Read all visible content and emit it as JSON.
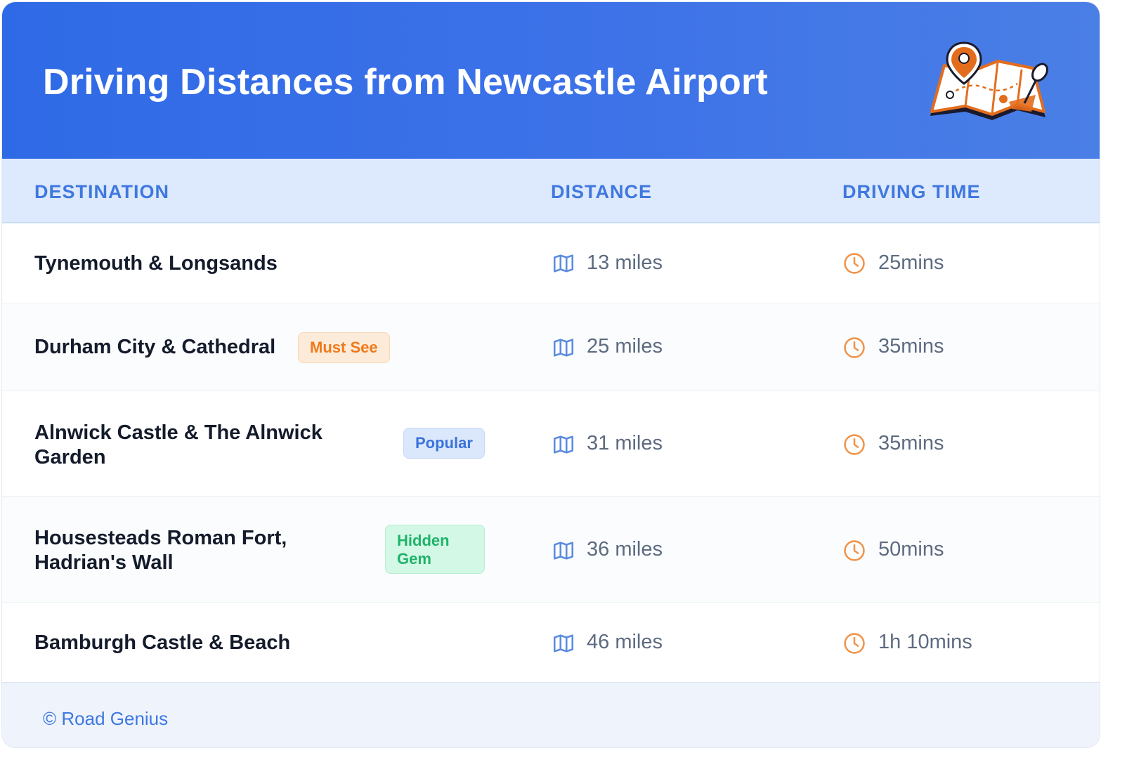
{
  "header": {
    "title": "Driving Distances from Newcastle Airport"
  },
  "columns": {
    "destination": "DESTINATION",
    "distance": "DISTANCE",
    "time": "DRIVING TIME"
  },
  "rows": [
    {
      "destination": "Tynemouth & Longsands",
      "badge": "",
      "distance": "13 miles",
      "time": "25mins"
    },
    {
      "destination": "Durham City & Cathedral",
      "badge": "Must See",
      "distance": "25 miles",
      "time": "35mins"
    },
    {
      "destination": "Alnwick Castle & The Alnwick Garden",
      "badge": "Popular",
      "distance": "31 miles",
      "time": "35mins"
    },
    {
      "destination": "Housesteads Roman Fort, Hadrian's Wall",
      "badge": "Hidden Gem",
      "distance": "36 miles",
      "time": "50mins"
    },
    {
      "destination": "Bamburgh Castle & Beach",
      "badge": "",
      "distance": "46 miles",
      "time": "1h 10mins"
    }
  ],
  "footer": {
    "credit": "© Road Genius"
  },
  "icons": {
    "distance": "map-icon",
    "time": "clock-icon",
    "header": "map-pin-illustration"
  },
  "colors": {
    "header": "#2f6ae6",
    "accent": "#3f78e0",
    "clock": "#f0944a",
    "map": "#5b8be0"
  }
}
